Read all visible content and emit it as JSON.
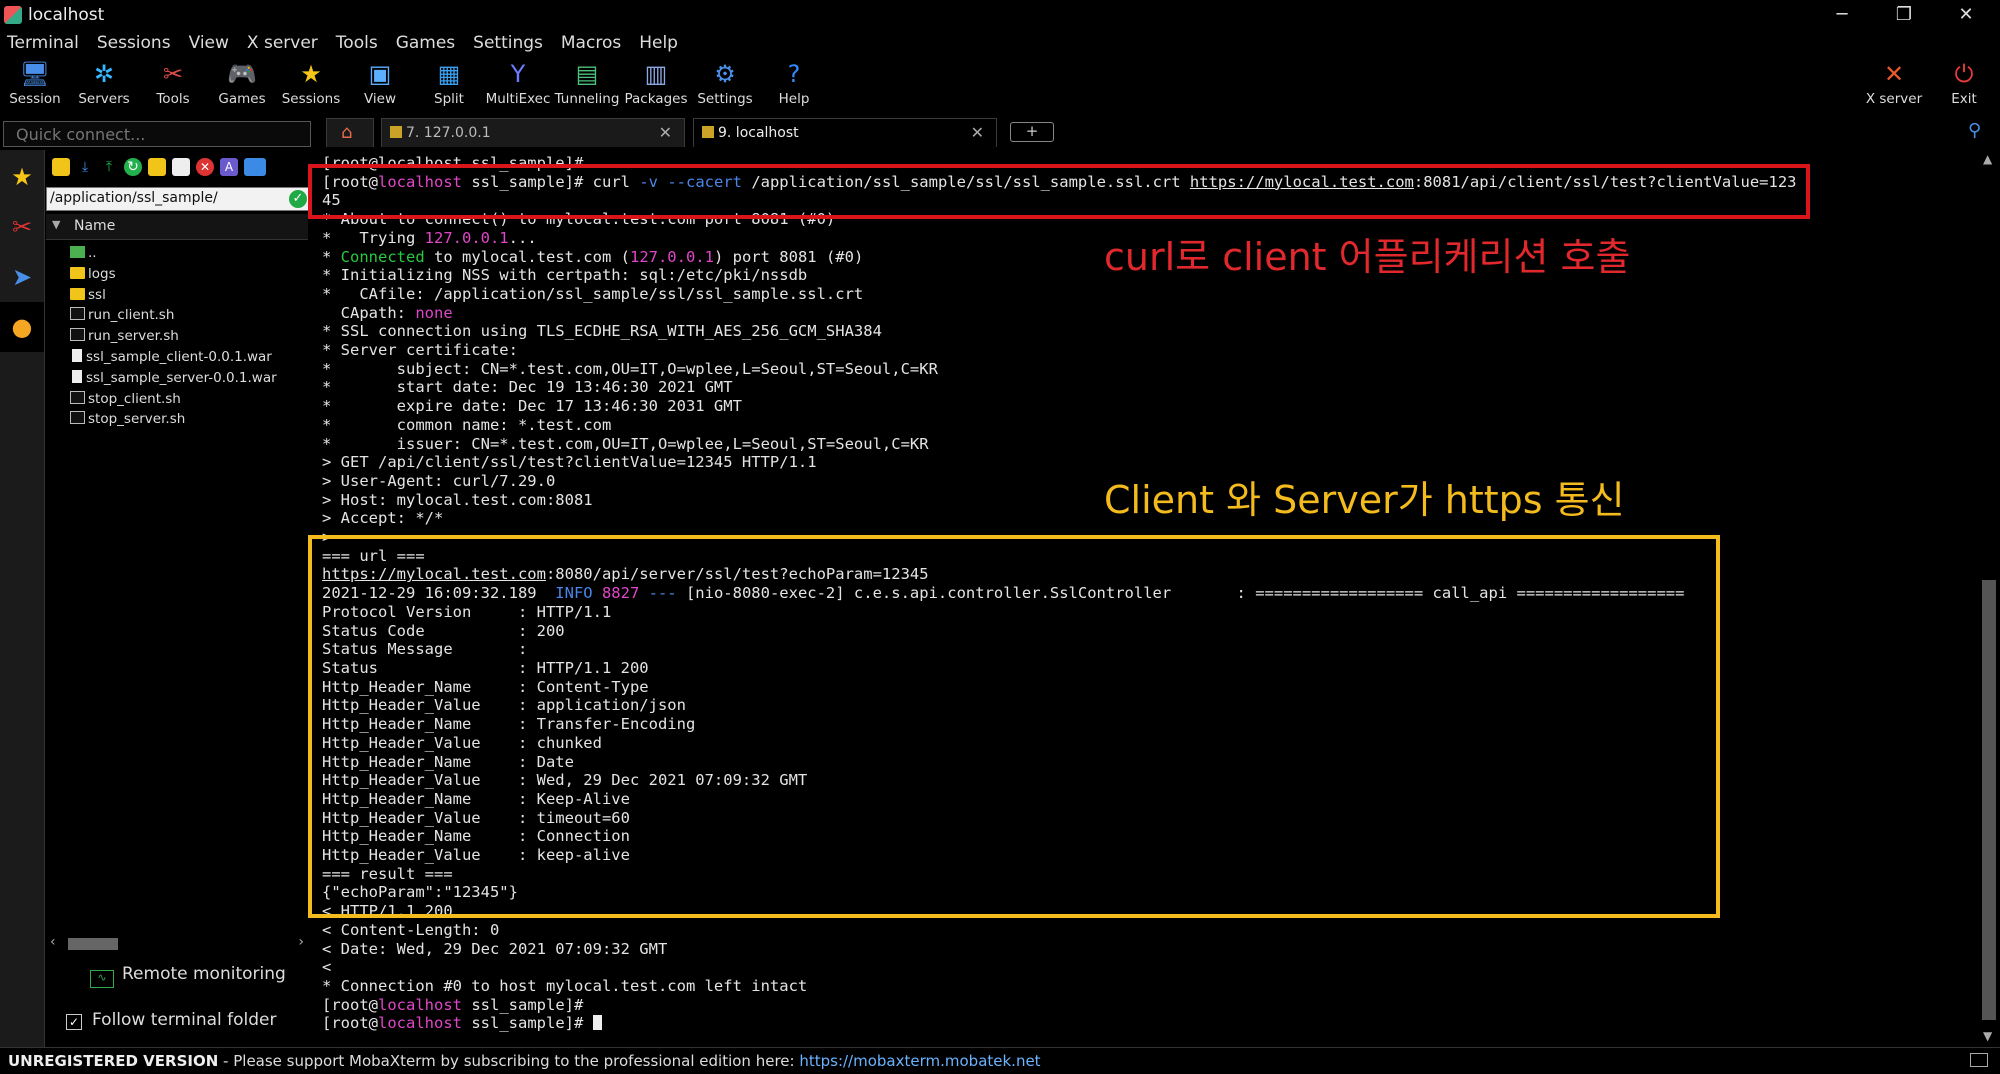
{
  "window": {
    "title": "localhost",
    "minimize": "─",
    "restore": "❐",
    "close": "✕"
  },
  "menu": [
    "Terminal",
    "Sessions",
    "View",
    "X server",
    "Tools",
    "Games",
    "Settings",
    "Macros",
    "Help"
  ],
  "toolbar": {
    "buttons": [
      {
        "label": "Session",
        "icon": "session-icon",
        "glyph": "🖥",
        "color": "#4a8fe7"
      },
      {
        "label": "Servers",
        "icon": "servers-icon",
        "glyph": "✲",
        "color": "#38b6ff"
      },
      {
        "label": "Tools",
        "icon": "tools-icon",
        "glyph": "✂",
        "color": "#e34b4b"
      },
      {
        "label": "Games",
        "icon": "games-icon",
        "glyph": "🎮",
        "color": "#cccccc"
      },
      {
        "label": "Sessions",
        "icon": "sessions-star-icon",
        "glyph": "★",
        "color": "#f5c518"
      },
      {
        "label": "View",
        "icon": "view-icon",
        "glyph": "▣",
        "color": "#5ab0ff"
      },
      {
        "label": "Split",
        "icon": "split-icon",
        "glyph": "▦",
        "color": "#3aa0f0"
      },
      {
        "label": "MultiExec",
        "icon": "multiexec-icon",
        "glyph": "Y",
        "color": "#6a7cff"
      },
      {
        "label": "Tunneling",
        "icon": "tunneling-icon",
        "glyph": "▤",
        "color": "#4cc07a"
      },
      {
        "label": "Packages",
        "icon": "packages-icon",
        "glyph": "▥",
        "color": "#8aa7e6"
      },
      {
        "label": "Settings",
        "icon": "settings-icon",
        "glyph": "⚙",
        "color": "#4a8fe7"
      },
      {
        "label": "Help",
        "icon": "help-icon",
        "glyph": "?",
        "color": "#2f8cff"
      }
    ],
    "right": [
      {
        "label": "X server",
        "icon": "xserver-icon",
        "glyph": "✕",
        "color": "#e65a2c"
      },
      {
        "label": "Exit",
        "icon": "exit-icon",
        "glyph": "⏻",
        "color": "#e23b3b"
      }
    ]
  },
  "quick_connect": {
    "placeholder": "Quick connect..."
  },
  "tabs": [
    {
      "name": "7. 127.0.0.1",
      "close": "✕"
    },
    {
      "name": "9. localhost",
      "close": "✕"
    }
  ],
  "sidebar": {
    "path": "/application/ssl_sample/",
    "column": "Name",
    "files": [
      {
        "name": "..",
        "type": "up"
      },
      {
        "name": "logs",
        "type": "folder"
      },
      {
        "name": "ssl",
        "type": "folder"
      },
      {
        "name": "run_client.sh",
        "type": "sh"
      },
      {
        "name": "run_server.sh",
        "type": "sh"
      },
      {
        "name": "ssl_sample_client-0.0.1.war",
        "type": "war"
      },
      {
        "name": "ssl_sample_server-0.0.1.war",
        "type": "war"
      },
      {
        "name": "stop_client.sh",
        "type": "sh"
      },
      {
        "name": "stop_server.sh",
        "type": "sh"
      }
    ],
    "remote_monitoring": "Remote monitoring",
    "follow_folder": "Follow terminal folder"
  },
  "terminal": {
    "prompt_user": "[root@",
    "prompt_host": "localhost",
    "prompt_dir": " ssl_sample]# ",
    "line0": "[root@localhost ssl_sample]#",
    "cmd_curl": "curl",
    "cmd_flags": "-v --cacert",
    "cmd_path": " /application/ssl_sample/ssl/ssl_sample.ssl.crt ",
    "cmd_url_host": "https://mylocal.test.com",
    "cmd_url_rest": ":8081/api/client/ssl/test?clientValue=123",
    "cmd_wrap": "45",
    "about": "* About to connect() to mylocal.test.com port 8081 (#0)",
    "trying_pre": "*   Trying ",
    "trying_ip": "127.0.0.1",
    "trying_post": "...",
    "connected_pre": "* ",
    "connected_word": "Connected",
    "connected_mid": " to mylocal.test.com (",
    "connected_ip": "127.0.0.1",
    "connected_post": ") port 8081 (#0)",
    "lines_a": [
      "* Initializing NSS with certpath: sql:/etc/pki/nssdb",
      "*   CAfile: /application/ssl_sample/ssl/ssl_sample.ssl.crt"
    ],
    "capath_pre": "  CApath: ",
    "capath_val": "none",
    "lines_b": [
      "* SSL connection using TLS_ECDHE_RSA_WITH_AES_256_GCM_SHA384",
      "* Server certificate:",
      "*       subject: CN=*.test.com,OU=IT,O=wplee,L=Seoul,ST=Seoul,C=KR",
      "*       start date: Dec 19 13:46:30 2021 GMT",
      "*       expire date: Dec 17 13:46:30 2031 GMT",
      "*       common name: *.test.com",
      "*       issuer: CN=*.test.com,OU=IT,O=wplee,L=Seoul,ST=Seoul,C=KR",
      "> GET /api/client/ssl/test?clientValue=12345 HTTP/1.1",
      "> User-Agent: curl/7.29.0",
      "> Host: mylocal.test.com:8081",
      "> Accept: */*",
      ">",
      "=== url ==="
    ],
    "url_host": "https://mylocal.test.com",
    "url_rest": ":8080/api/server/ssl/test?echoParam=12345",
    "log_time": "2021-12-29 16:09:32.189  ",
    "log_level": "INFO",
    "log_pid": " 8827 ",
    "log_sep": "---",
    "log_rest": " [nio-8080-exec-2] c.e.s.api.controller.SslController       : ================== call_api ==================",
    "lines_c": [
      "Protocol Version     : HTTP/1.1",
      "Status Code          : 200",
      "Status Message       :",
      "Status               : HTTP/1.1 200",
      "Http_Header_Name     : Content-Type",
      "Http_Header_Value    : application/json",
      "Http_Header_Name     : Transfer-Encoding",
      "Http_Header_Value    : chunked",
      "Http_Header_Name     : Date",
      "Http_Header_Value    : Wed, 29 Dec 2021 07:09:32 GMT",
      "Http_Header_Name     : Keep-Alive",
      "Http_Header_Value    : timeout=60",
      "Http_Header_Name     : Connection",
      "Http_Header_Value    : keep-alive",
      "=== result ===",
      "{\"echoParam\":\"12345\"}",
      "< HTTP/1.1 200",
      "< Content-Length: 0",
      "< Date: Wed, 29 Dec 2021 07:09:32 GMT",
      "<",
      "* Connection #0 to host mylocal.test.com left intact"
    ]
  },
  "annotations": {
    "red": "curl로 client 어플리케리션 호출",
    "yellow": "Client 와 Server가 https 통신"
  },
  "status": {
    "unregistered": "UNREGISTERED VERSION",
    "message": "  -  Please support MobaXterm by subscribing to the professional edition here:  ",
    "link": "https://mobaxterm.mobatek.net"
  }
}
